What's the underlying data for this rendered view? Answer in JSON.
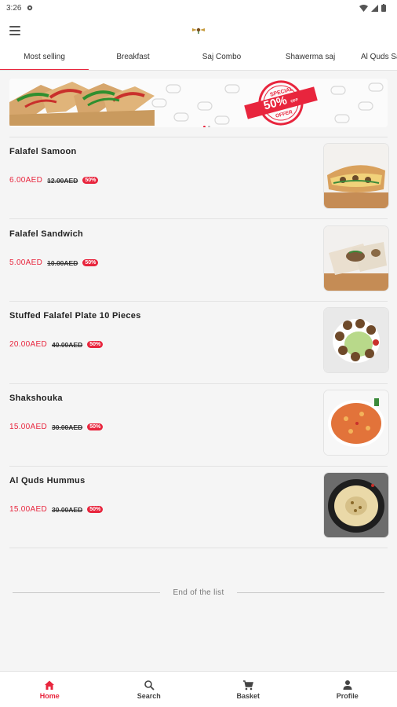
{
  "status_bar": {
    "time": "3:26"
  },
  "tabs": [
    {
      "label": "Most selling"
    },
    {
      "label": "Breakfast"
    },
    {
      "label": "Saj Combo"
    },
    {
      "label": "Shawerma saj"
    },
    {
      "label": "Al Quds Sa"
    }
  ],
  "banner": {
    "offer_text": "SPECIAL",
    "offer_percent": "50%",
    "offer_sub": "OFFER",
    "offer_off": "OFF"
  },
  "items": [
    {
      "name": "Falafel Samoon",
      "price": "6.00AED",
      "old_price": "12.00AED",
      "discount": "50%"
    },
    {
      "name": "Falafel Sandwich",
      "price": "5.00AED",
      "old_price": "10.00AED",
      "discount": "50%"
    },
    {
      "name": "Stuffed Falafel Plate 10 Pieces",
      "price": "20.00AED",
      "old_price": "40.00AED",
      "discount": "50%"
    },
    {
      "name": "Shakshouka",
      "price": "15.00AED",
      "old_price": "30.00AED",
      "discount": "50%"
    },
    {
      "name": "Al Quds Hummus",
      "price": "15.00AED",
      "old_price": "30.00AED",
      "discount": "50%"
    }
  ],
  "end_text": "End of the list",
  "bottom_nav": [
    {
      "label": "Home",
      "icon": "home-icon"
    },
    {
      "label": "Search",
      "icon": "search-icon"
    },
    {
      "label": "Basket",
      "icon": "cart-icon"
    },
    {
      "label": "Profile",
      "icon": "person-icon"
    }
  ],
  "colors": {
    "accent": "#e8253d"
  }
}
